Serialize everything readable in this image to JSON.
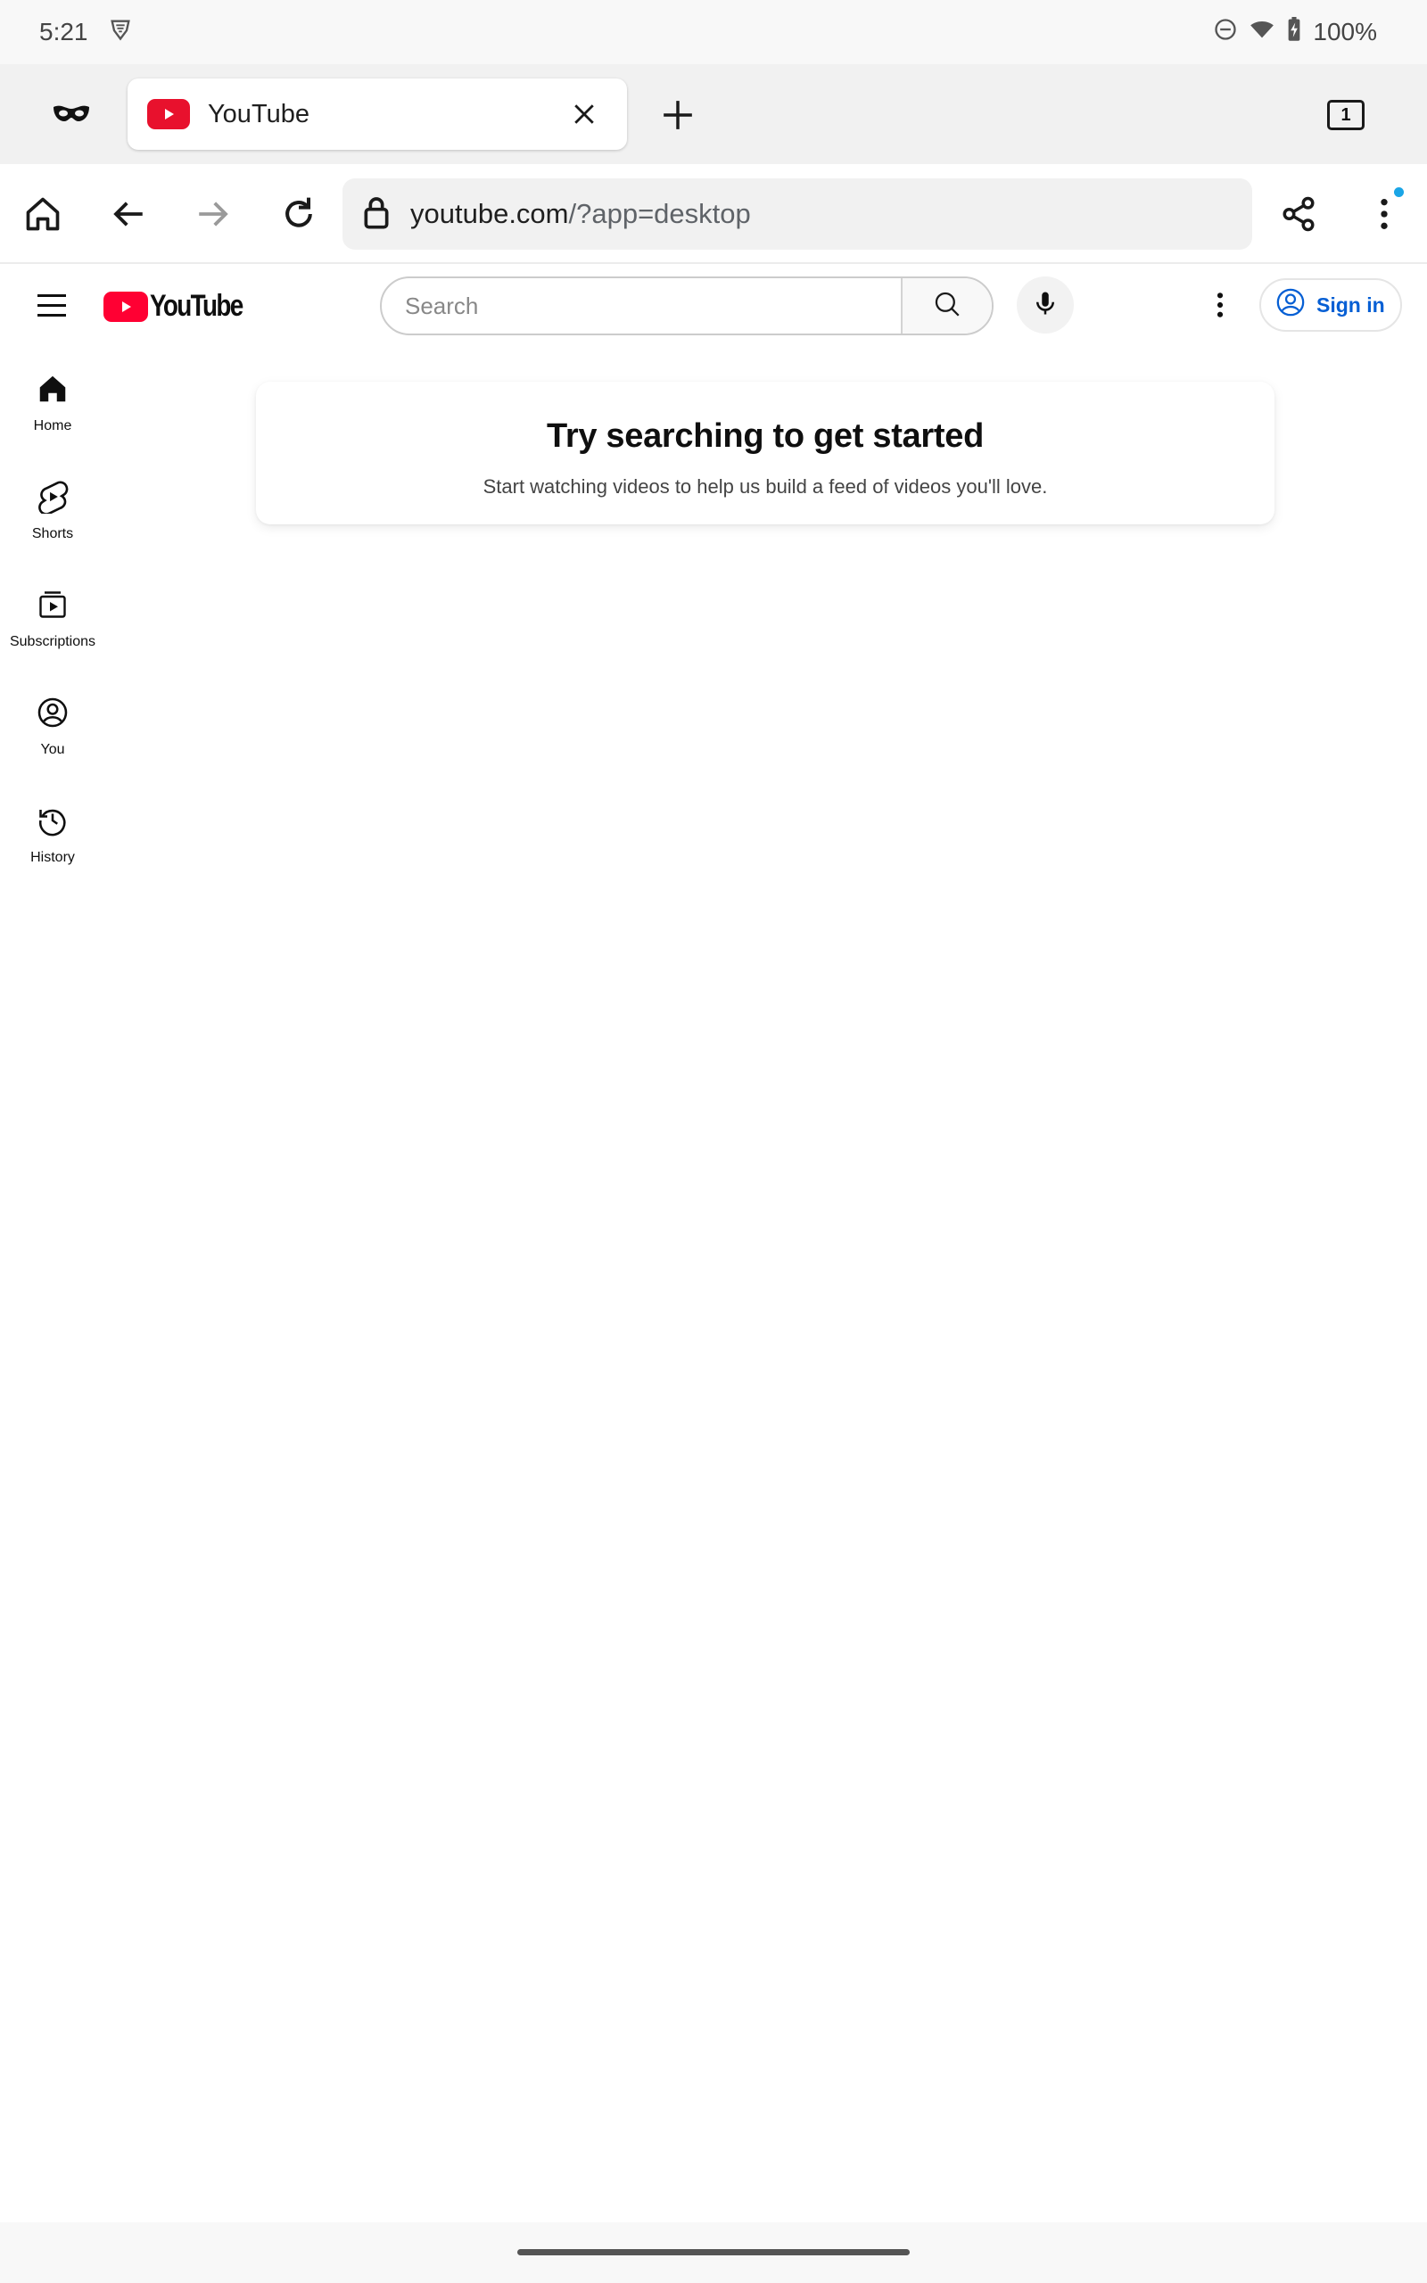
{
  "statusbar": {
    "time": "5:21",
    "battery": "100%"
  },
  "browser": {
    "tab_title": "YouTube",
    "tab_count": "1",
    "url_host": "youtube.com",
    "url_path": "/?app=desktop"
  },
  "youtube": {
    "logo_text": "YouTube",
    "search_placeholder": "Search",
    "signin_label": "Sign in",
    "guide": [
      {
        "label": "Home"
      },
      {
        "label": "Shorts"
      },
      {
        "label": "Subscriptions"
      },
      {
        "label": "You"
      },
      {
        "label": "History"
      }
    ],
    "empty_state": {
      "title": "Try searching to get started",
      "subtitle": "Start watching videos to help us build a feed of videos you'll love."
    }
  },
  "colors": {
    "brand_red": "#ff0033",
    "signin_blue": "#065fd4",
    "notification_dot": "#1aa5e6"
  }
}
